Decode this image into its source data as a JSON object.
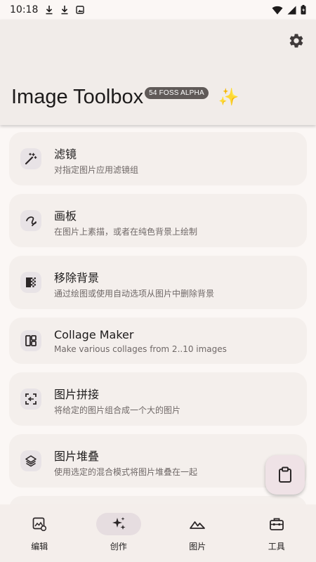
{
  "status_bar": {
    "time": "10:18"
  },
  "header": {
    "title": "Image Toolbox",
    "badge": "54 FOSS  ALPHA",
    "sparkle": "✨"
  },
  "tools": [
    {
      "title": "滤镜",
      "subtitle": "对指定图片应用滤镜组",
      "icon": "magic-wand-icon"
    },
    {
      "title": "画板",
      "subtitle": "在图片上素描，或者在纯色背景上绘制",
      "icon": "draw-icon"
    },
    {
      "title": "移除背景",
      "subtitle": "通过绘图或使用自动选项从图片中删除背景",
      "icon": "transparency-icon"
    },
    {
      "title": "Collage Maker",
      "subtitle": "Make various collages from 2..10 images",
      "icon": "collage-icon"
    },
    {
      "title": "图片拼接",
      "subtitle": "将给定的图片组合成一个大的图片",
      "icon": "stitch-icon"
    },
    {
      "title": "图片堆叠",
      "subtitle": "使用选定的混合模式将图片堆叠在一起",
      "icon": "layers-icon"
    }
  ],
  "nav": [
    {
      "label": "编辑",
      "icon": "edit-image-icon",
      "active": false
    },
    {
      "label": "创作",
      "icon": "sparkles-icon",
      "active": true
    },
    {
      "label": "图片",
      "icon": "landscape-icon",
      "active": false
    },
    {
      "label": "工具",
      "icon": "toolbox-icon",
      "active": false
    }
  ]
}
